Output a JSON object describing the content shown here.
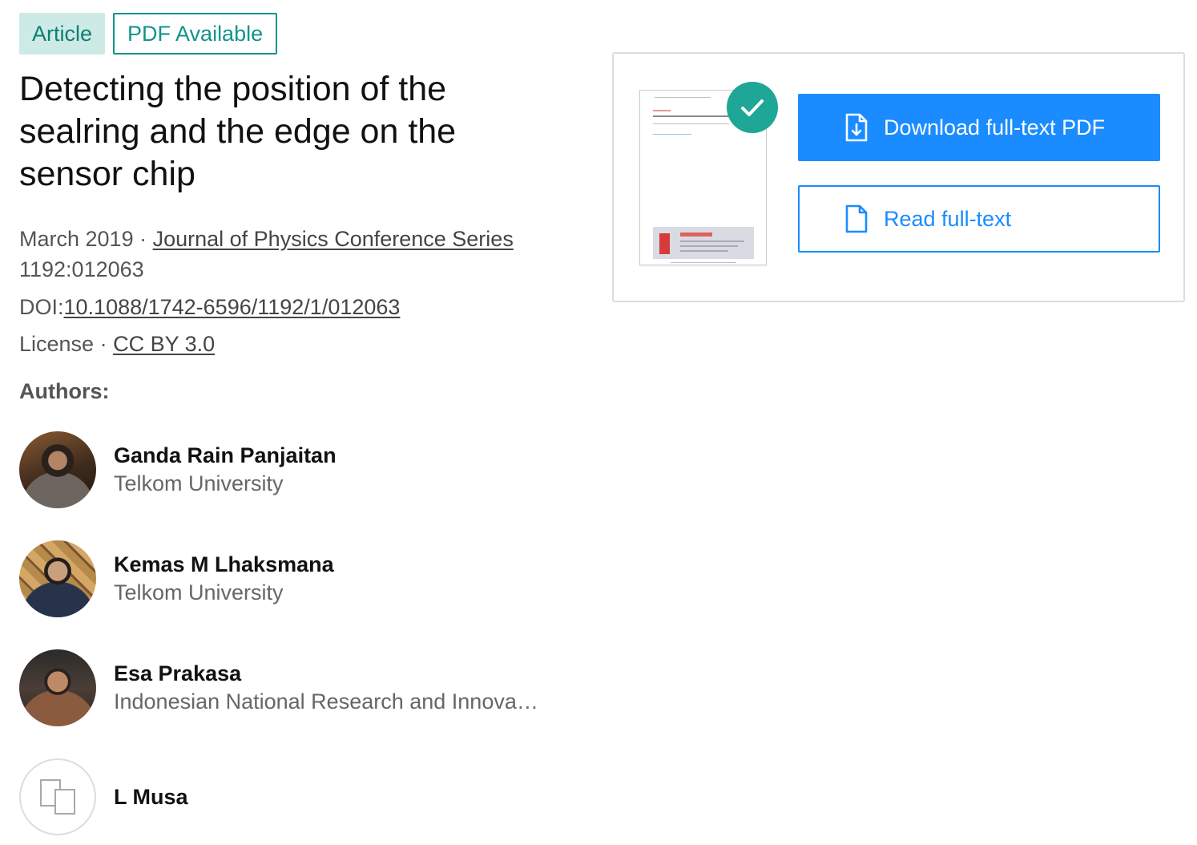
{
  "badges": {
    "type": "Article",
    "availability": "PDF Available"
  },
  "title": "Detecting the position of the sealring and the edge on the sensor chip",
  "meta": {
    "date": "March 2019",
    "separator": " · ",
    "journal": "Journal of Physics Conference Series",
    "volume": "1192:012063",
    "doi_label": "DOI:",
    "doi": "10.1088/1742-6596/1192/1/012063",
    "license_label": "License",
    "license": "CC BY 3.0"
  },
  "authors_heading": "Authors:",
  "authors": [
    {
      "name": "Ganda Rain Panjaitan",
      "institution": "Telkom University"
    },
    {
      "name": "Kemas M Lhaksmana",
      "institution": "Telkom University"
    },
    {
      "name": "Esa Prakasa",
      "institution": "Indonesian National Research and Innovation Agency"
    },
    {
      "name": "L Musa",
      "institution": ""
    }
  ],
  "fulltext": {
    "download_label": "Download full-text PDF",
    "read_label": "Read full-text"
  },
  "colors": {
    "primary": "#1a8cff",
    "accent_teal": "#11948a",
    "badge_bg": "#cdeae6"
  },
  "icons": {
    "download": "file-download-icon",
    "read": "file-icon",
    "check": "check-icon",
    "placeholder_avatar": "overlapping-squares-icon"
  }
}
